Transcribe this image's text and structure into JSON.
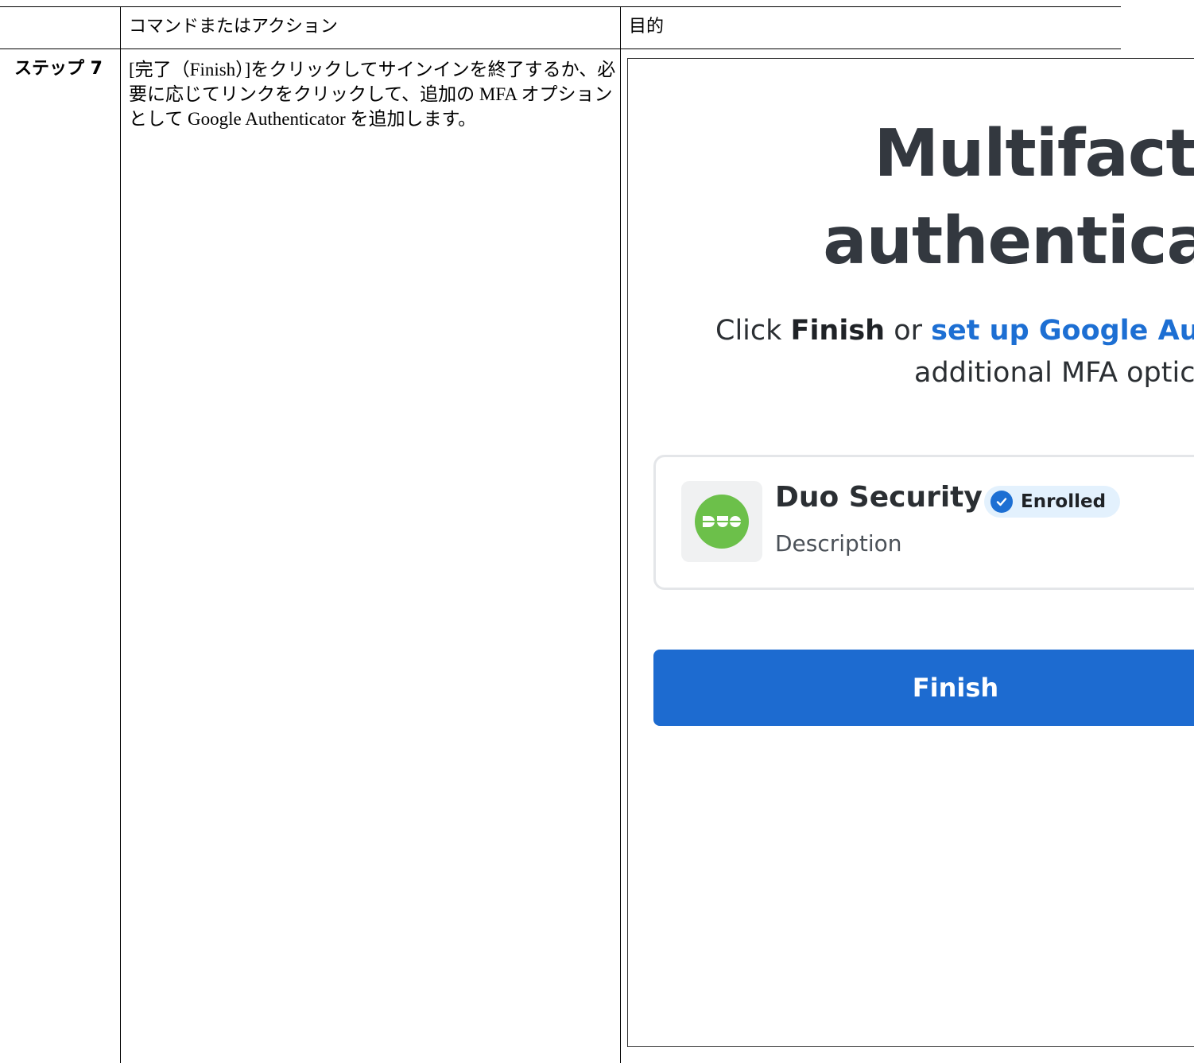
{
  "table": {
    "header": {
      "command_action": "コマンドまたはアクション",
      "purpose": "目的"
    },
    "rows": [
      {
        "step_label": "ステップ 7",
        "description": "[完了（Finish）]をクリックしてサインインを終了するか、必要に応じてリンクをクリックして、追加の MFA オプションとして Google Authenticator を追加します。"
      }
    ]
  },
  "screenshot": {
    "title_line1": "Multifacto",
    "title_line2": "authenticat",
    "subtitle": {
      "prefix": "Click ",
      "finish_word": "Finish",
      "or_word": " or ",
      "link_text": "set up Google Aut",
      "line2": "additional MFA optic"
    },
    "card": {
      "name": "Duo Security",
      "badge": "Enrolled",
      "description": "Description",
      "logo_icon": "duo-logo"
    },
    "finish_button": "Finish",
    "colors": {
      "primary": "#1d6bd0",
      "link": "#1d6fd3",
      "duo_green": "#6cc04a",
      "badge_bg": "#e3f1fd"
    }
  }
}
